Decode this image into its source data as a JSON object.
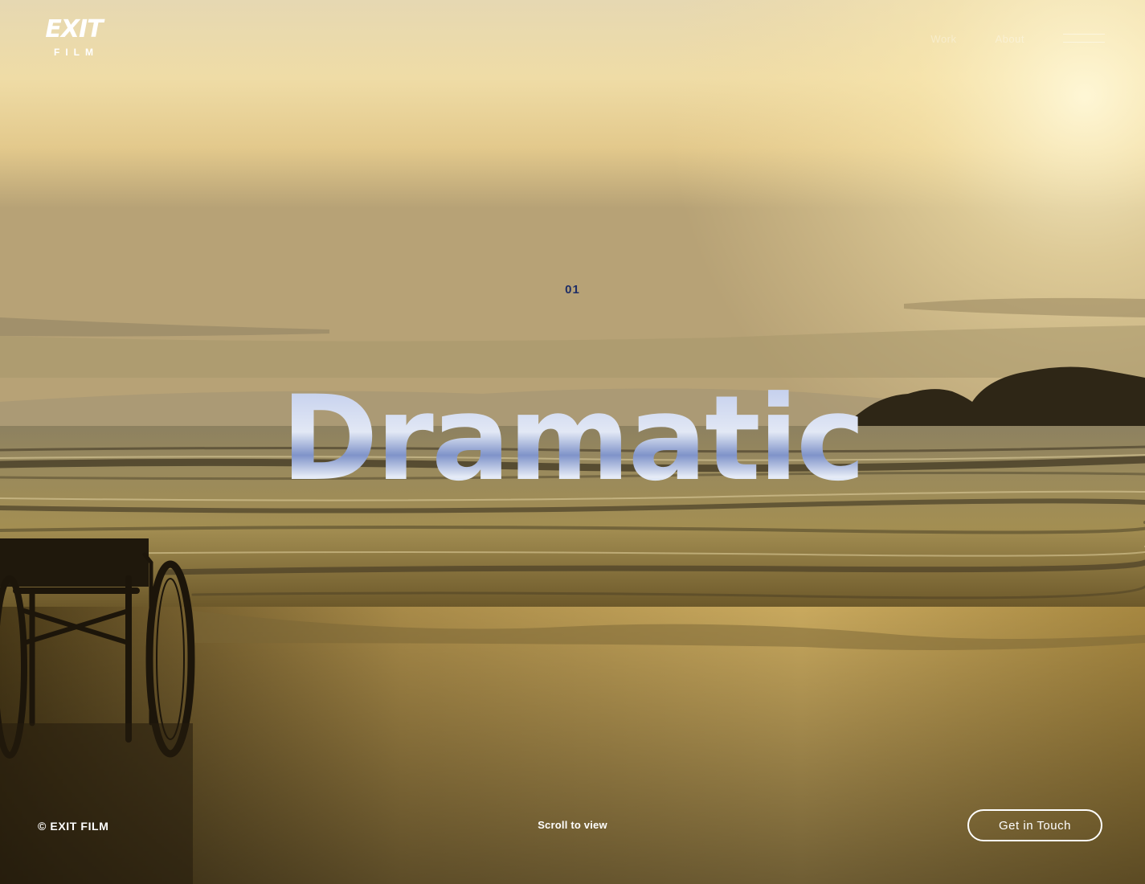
{
  "brand": {
    "logo_word": "EXIT",
    "logo_sub": "FILM"
  },
  "nav": {
    "links": [
      "Work",
      "About"
    ],
    "menu_icon": "hamburger-icon"
  },
  "hero": {
    "slide_number": "01",
    "headline": "Dramatic",
    "scroll_hint": "Scroll to view"
  },
  "footer": {
    "copyright": "© EXIT FILM",
    "cta_label": "Get in Touch"
  },
  "colors": {
    "accent_number": "#1f2e66",
    "headline_top": "#b9c6ea",
    "headline_mid": "#7f93c9",
    "headline_bottom": "#e6ecf7"
  }
}
